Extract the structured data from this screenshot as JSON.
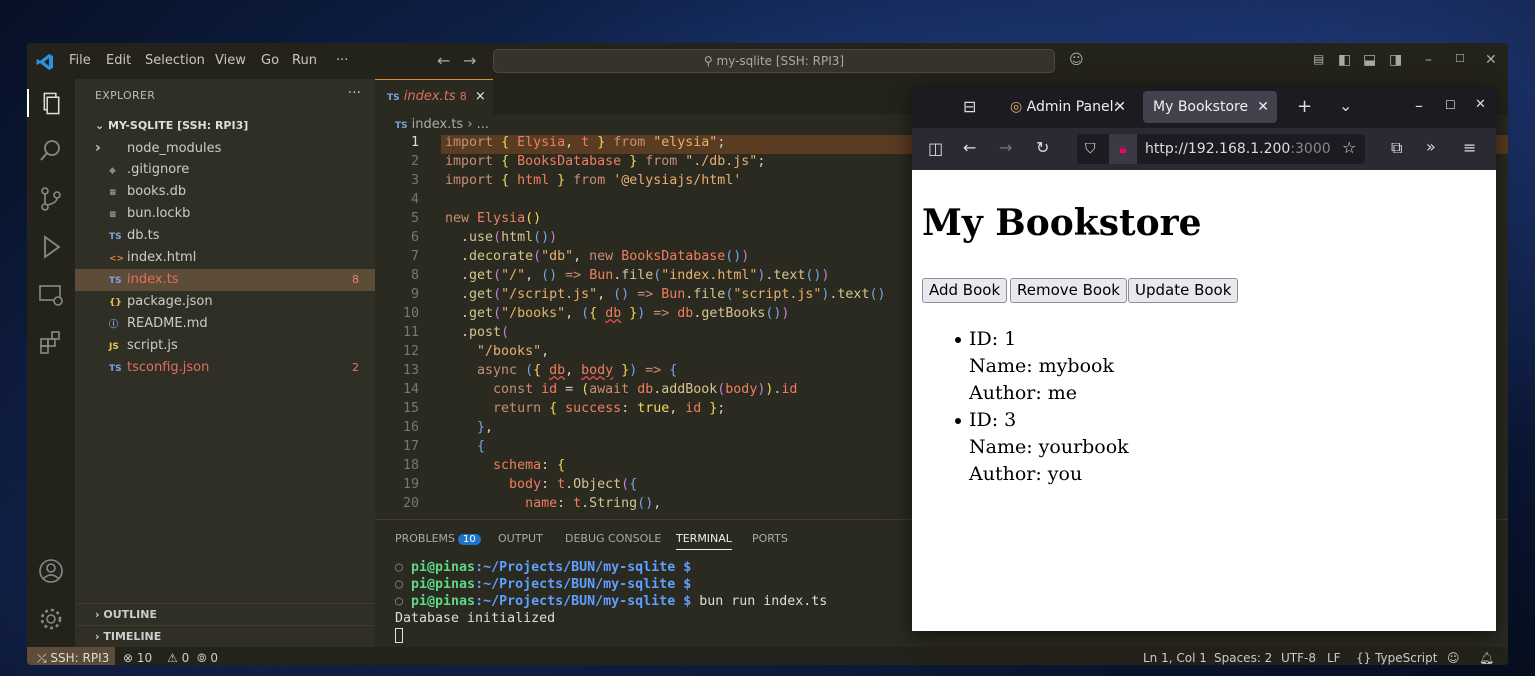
{
  "vscode": {
    "menu": [
      "File",
      "Edit",
      "Selection",
      "View",
      "Go",
      "Run",
      "···"
    ],
    "search": "my-sqlite [SSH: RPI3]",
    "explorer_title": "EXPLORER",
    "project": "MY-SQLITE [SSH: RPI3]",
    "files": [
      {
        "name": "node_modules",
        "icon": "›",
        "color": "#cccccc",
        "count": ""
      },
      {
        "name": ".gitignore",
        "icon": "◆",
        "color": "#cccccc",
        "count": ""
      },
      {
        "name": "books.db",
        "icon": "≡",
        "color": "#cccccc",
        "count": ""
      },
      {
        "name": "bun.lockb",
        "icon": "≡",
        "color": "#cccccc",
        "count": ""
      },
      {
        "name": "db.ts",
        "icon": "TS",
        "color": "#cccccc",
        "count": ""
      },
      {
        "name": "index.html",
        "icon": "<>",
        "color": "#cccccc",
        "count": ""
      },
      {
        "name": "index.ts",
        "icon": "TS",
        "color": "#e06f5c",
        "count": "8"
      },
      {
        "name": "package.json",
        "icon": "{}",
        "color": "#cccccc",
        "count": ""
      },
      {
        "name": "README.md",
        "icon": "ⓘ",
        "color": "#cccccc",
        "count": ""
      },
      {
        "name": "script.js",
        "icon": "JS",
        "color": "#cccccc",
        "count": ""
      },
      {
        "name": "tsconfig.json",
        "icon": "TS",
        "color": "#e06f5c",
        "count": "2"
      }
    ],
    "outline": "OUTLINE",
    "timeline": "TIMELINE",
    "tab": {
      "icon": "TS",
      "name": "index.ts",
      "count": "8",
      "close": "×"
    },
    "breadcrumb": "index.ts › ...",
    "line_numbers": [
      "1",
      "2",
      "3",
      "4",
      "5",
      "6",
      "7",
      "8",
      "9",
      "10",
      "11",
      "12",
      "13",
      "14",
      "15",
      "16",
      "17",
      "18",
      "19",
      "20"
    ],
    "panel_tabs": [
      "PROBLEMS",
      "OUTPUT",
      "DEBUG CONSOLE",
      "TERMINAL",
      "PORTS"
    ],
    "problems_count": "10",
    "terminal": {
      "prompt": "pi@pinas",
      "path": ":~/Projects/BUN/my-sqlite $",
      "command": " bun run index.ts",
      "output": "Database initialized"
    },
    "status": {
      "remote": "SSH: RPI3",
      "errors": "⊗ 10",
      "warnings": "⚠ 0",
      "ports": "0",
      "position": "Ln 1, Col 1",
      "spaces": "Spaces: 2",
      "encoding": "UTF-8",
      "eol": "LF",
      "language": "{} TypeScript"
    }
  },
  "firefox": {
    "tab1": "Admin Panel:",
    "tab2": "My Bookstore",
    "url_host": "http://192.168.1.200",
    "url_port": ":3000"
  },
  "page": {
    "title": "My Bookstore",
    "buttons": [
      "Add Book",
      "Remove Book",
      "Update Book"
    ],
    "books": [
      {
        "id": "ID: 1",
        "name": "Name: mybook",
        "author": "Author: me"
      },
      {
        "id": "ID: 3",
        "name": "Name: yourbook",
        "author": "Author: you"
      }
    ]
  }
}
